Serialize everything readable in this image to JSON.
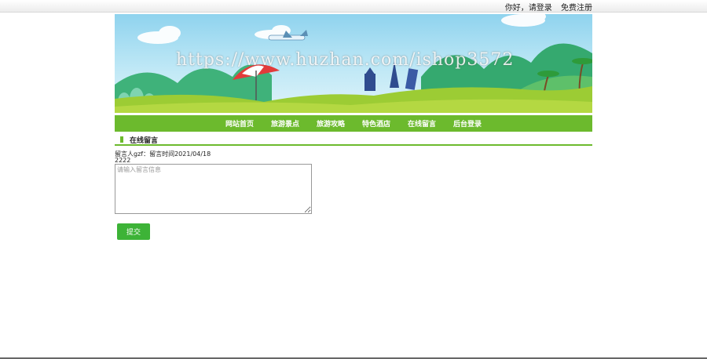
{
  "topbar": {
    "greeting": "你好，",
    "login": "请登录",
    "register": "免费注册"
  },
  "banner": {
    "watermark": "https://www.huzhan.com/ishop3572"
  },
  "nav": {
    "items": [
      "网站首页",
      "旅游景点",
      "旅游攻略",
      "特色酒店",
      "在线留言",
      "后台登录"
    ]
  },
  "section": {
    "title": "在线留言"
  },
  "message": {
    "meta": "留言人gzf：留言时间2021/04/18",
    "content": "2222"
  },
  "form": {
    "placeholder": "请输入留言信息",
    "submit_label": "提交"
  },
  "colors": {
    "nav_green": "#6cba2d",
    "button_green": "#3db337"
  }
}
